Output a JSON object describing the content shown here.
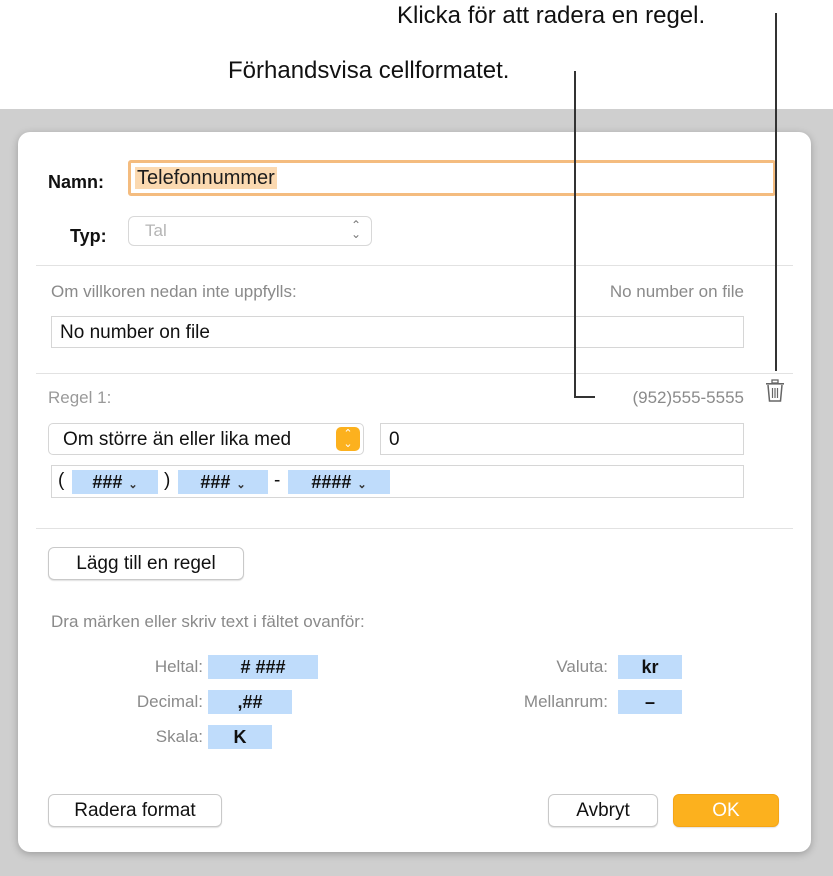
{
  "callouts": {
    "delete_rule": "Klicka för att radera en regel.",
    "preview_format": "Förhandsvisa cellformatet."
  },
  "form": {
    "name_label": "Namn:",
    "name_value": "Telefonnummer",
    "type_label": "Typ:",
    "type_value": "Tal"
  },
  "fallback": {
    "label": "Om villkoren nedan inte uppfylls:",
    "preview": "No number on file",
    "value": "No number on file"
  },
  "rule": {
    "label": "Regel 1:",
    "preview": "(952)555-5555",
    "condition": "Om större än eller lika med",
    "condition_value": "0",
    "format_tokens": [
      {
        "prefix": "(",
        "token": "###"
      },
      {
        "prefix": ")",
        "token": "###"
      },
      {
        "prefix": "-",
        "token": "####"
      }
    ]
  },
  "add_rule_button": "Lägg till en regel",
  "tokens_section": {
    "hint": "Dra märken eller skriv text i fältet ovanför:",
    "left": [
      {
        "label": "Heltal:",
        "token": "# ###"
      },
      {
        "label": "Decimal:",
        "token": ",##"
      },
      {
        "label": "Skala:",
        "token": "K"
      }
    ],
    "right": [
      {
        "label": "Valuta:",
        "token": "kr"
      },
      {
        "label": "Mellanrum:",
        "token": "–"
      }
    ]
  },
  "buttons": {
    "delete_format": "Radera format",
    "cancel": "Avbryt",
    "ok": "OK"
  },
  "icons": {
    "trash": "trash-icon",
    "select_arrows": "updown-chevron-icon",
    "token_menu": "chevron-down-icon"
  },
  "colors": {
    "accent": "#fcb11e",
    "focus_ring": "#f4bc7f",
    "token": "#bfdcfb"
  }
}
